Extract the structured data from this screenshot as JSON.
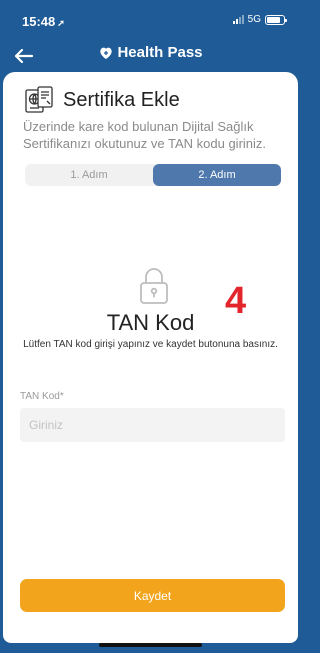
{
  "status_bar": {
    "time": "15:48",
    "location_arrow": "➚",
    "network": "5G"
  },
  "header": {
    "back_icon": "back-arrow-icon",
    "logo_icon": "heart-logo-icon",
    "logo_text": "Health Pass"
  },
  "page": {
    "title": "Sertifika Ekle",
    "title_icon": "certificate-passport-icon",
    "description": "Üzerinde kare kod bulunan Dijital Sağlık Sertifikanızı okutunuz ve TAN kodu giriniz.",
    "steps": [
      {
        "label": "1. Adım",
        "active": false
      },
      {
        "label": "2. Adım",
        "active": true
      }
    ],
    "lock_icon": "lock-icon",
    "section_title": "TAN Kod",
    "step_number": "4",
    "instruction": "Lütfen TAN kod girişi yapınız ve kaydet butonuna basınız.",
    "field": {
      "label": "TAN Kod*",
      "placeholder": "Giriniz",
      "value": ""
    },
    "save_label": "Kaydet"
  },
  "colors": {
    "header_bg": "#1e5b97",
    "active_step": "#4f79ad",
    "save_button": "#f2a41c",
    "step_number": "#e3242b"
  }
}
